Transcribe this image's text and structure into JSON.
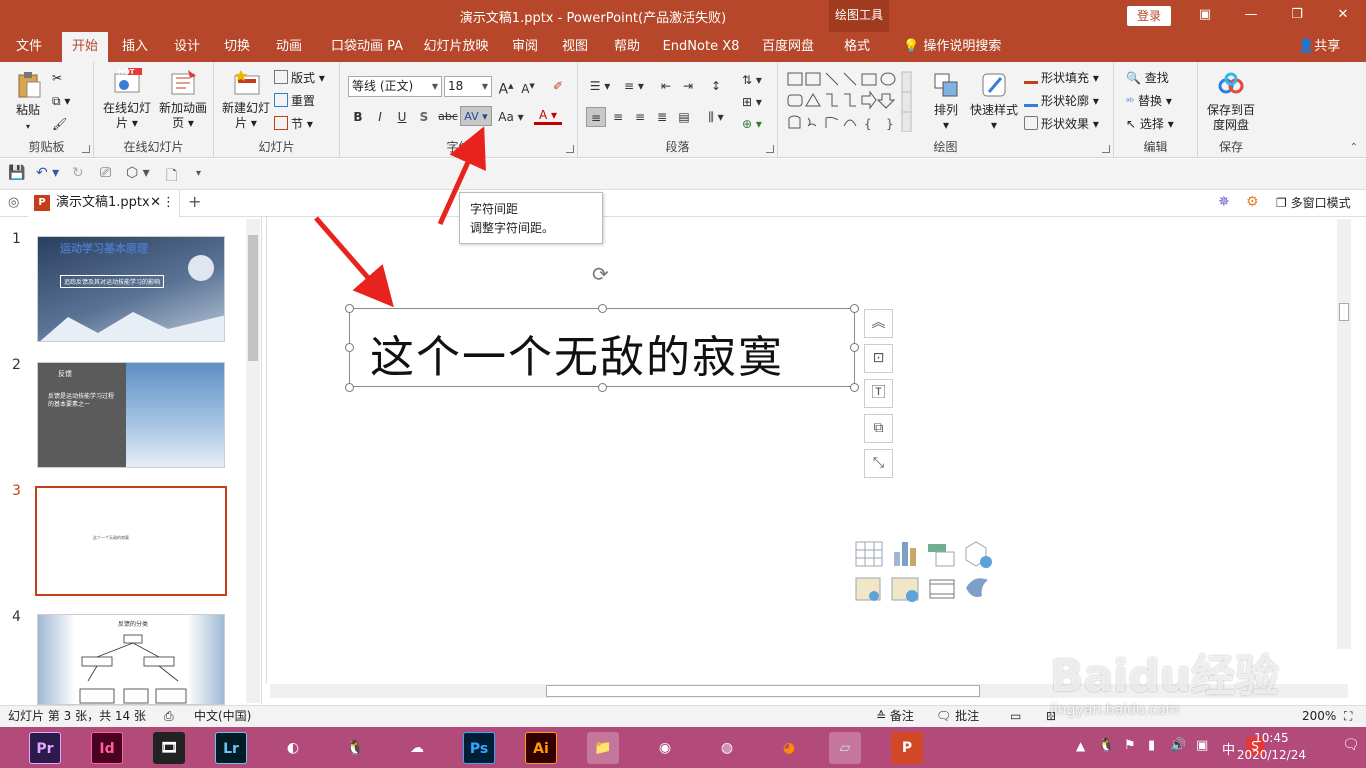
{
  "window": {
    "title": "演示文稿1.pptx  -  PowerPoint(产品激活失败)",
    "context_tool": "绘图工具",
    "login": "登录"
  },
  "tabs": [
    "文件",
    "开始",
    "插入",
    "设计",
    "切换",
    "动画",
    "口袋动画 PA",
    "幻灯片放映",
    "审阅",
    "视图",
    "帮助",
    "EndNote X8",
    "百度网盘",
    "格式"
  ],
  "active_tab": "开始",
  "search_label": "操作说明搜索",
  "share_label": "共享",
  "ribbon": {
    "clipboard": {
      "label": "剪贴板",
      "paste": "粘贴"
    },
    "online": {
      "label": "在线幻灯片",
      "online_slide": "在线幻灯片",
      "new_anim": "新加动画页",
      "hot": "HOT"
    },
    "slides": {
      "label": "幻灯片",
      "new_slide": "新建幻灯片",
      "layout": "版式",
      "reset": "重置",
      "section": "节"
    },
    "font": {
      "label": "字体",
      "font_name": "等线 (正文)",
      "font_size": "18",
      "bold": "B",
      "italic": "I",
      "underline": "U",
      "shadow": "S",
      "strike": "abc",
      "spacing": "AV",
      "case": "Aa",
      "color": "A"
    },
    "paragraph": {
      "label": "段落"
    },
    "drawing": {
      "label": "绘图",
      "arrange": "排列",
      "quick_style": "快速样式",
      "fill": "形状填充",
      "outline": "形状轮廓",
      "effect": "形状效果"
    },
    "editing": {
      "label": "编辑",
      "find": "查找",
      "replace": "替换",
      "select": "选择"
    },
    "save": {
      "label": "保存",
      "save_to": "保存到百度网盘"
    }
  },
  "doc_tab": "演示文稿1.pptx",
  "multi_window": "多窗口模式",
  "tooltip": {
    "title": "字符间距",
    "desc": "调整字符间距。"
  },
  "slides": [
    {
      "num": "1",
      "title": "运动学习基本原理",
      "subtitle": "追踪反馈及其对运动技能学习的影响"
    },
    {
      "num": "2",
      "title": "反馈",
      "body": "反馈是运动技能学习过程的基本要素之一"
    },
    {
      "num": "3",
      "caption": "这个一个无敌的寂寞"
    },
    {
      "num": "4",
      "title": "反馈的分类"
    }
  ],
  "textbox_text": "这个一个无敌的寂寞",
  "status": {
    "slide_info": "幻灯片 第 3 张，共 14 张",
    "language": "中文(中国)",
    "notes": "备注",
    "comments": "批注",
    "zoom": "200%"
  },
  "taskbar": {
    "apps": [
      "Pr",
      "Id",
      "Lr",
      "Ps",
      "Ai"
    ],
    "time": "10:45",
    "date": "2020/12/24",
    "ime": "中"
  },
  "watermark": {
    "main": "Baidu经验",
    "sub": "jingyan.baidu.com"
  },
  "colors": {
    "accent": "#b7472a",
    "taskbar": "#b24a7a",
    "annotation": "#e8231d"
  }
}
